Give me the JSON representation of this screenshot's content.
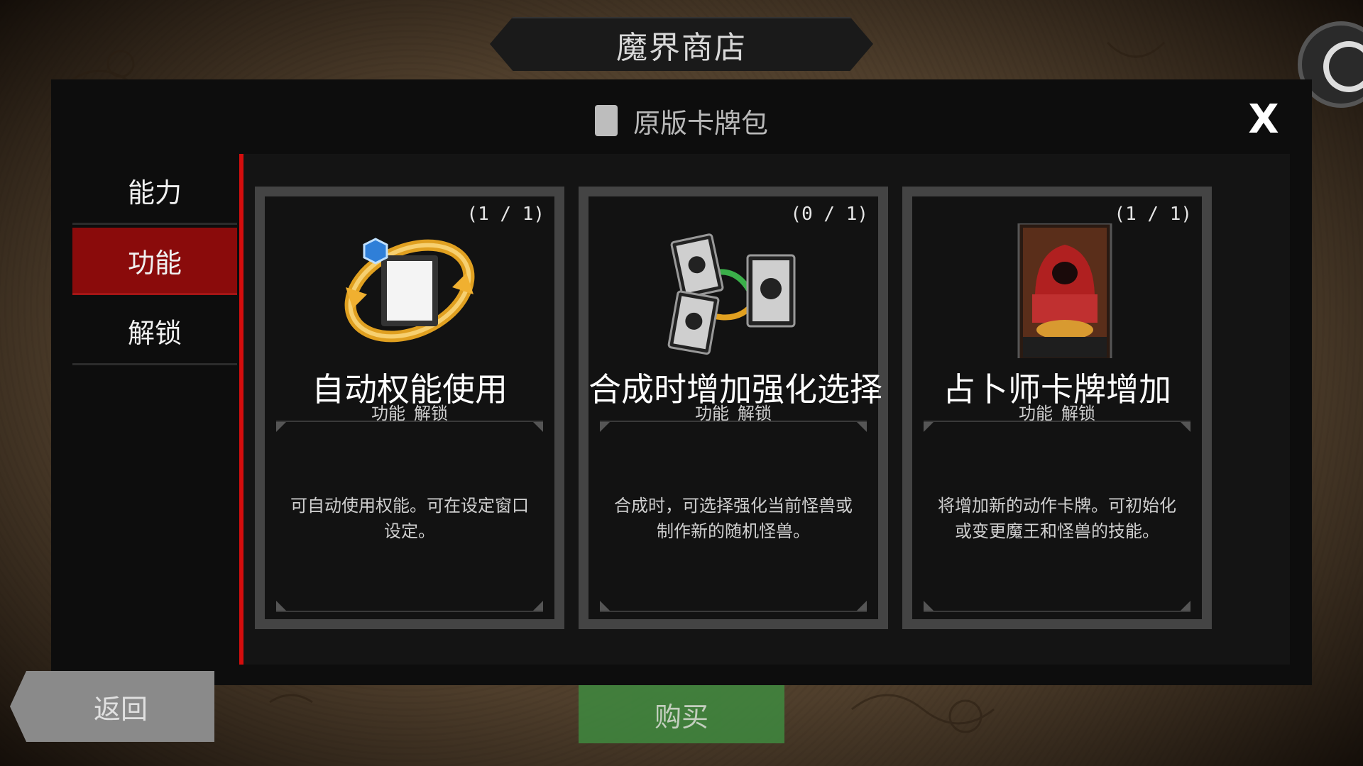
{
  "header": {
    "title": "魔界商店"
  },
  "panel": {
    "title": "原版卡牌包",
    "close_label": "X"
  },
  "sidebar": {
    "items": [
      {
        "label": "能力",
        "active": false
      },
      {
        "label": "功能",
        "active": true
      },
      {
        "label": "解锁",
        "active": false
      }
    ]
  },
  "cards": [
    {
      "count": "(1 / 1)",
      "name": "自动权能使用",
      "sub": [
        "功能",
        "解锁"
      ],
      "description": "可自动使用权能。可在设定窗口设定。",
      "icon": "auto-cycle-icon"
    },
    {
      "count": "(0 / 1)",
      "name": "合成时增加强化选择",
      "sub": [
        "功能",
        "解锁"
      ],
      "description": "合成时，可选择强化当前怪兽或制作新的随机怪兽。",
      "icon": "synthesis-cards-icon"
    },
    {
      "count": "(1 / 1)",
      "name": "占卜师卡牌增加",
      "sub": [
        "功能",
        "解锁"
      ],
      "description": "将增加新的动作卡牌。可初始化或变更魔王和怪兽的技能。",
      "icon": "fortune-teller-card-icon"
    }
  ],
  "footer": {
    "back_label": "返回",
    "buy_label": "购买"
  },
  "colors": {
    "active_tab": "#8a0b0b",
    "accent_bar": "#d40d0d",
    "buy": "#3f8a3f"
  }
}
